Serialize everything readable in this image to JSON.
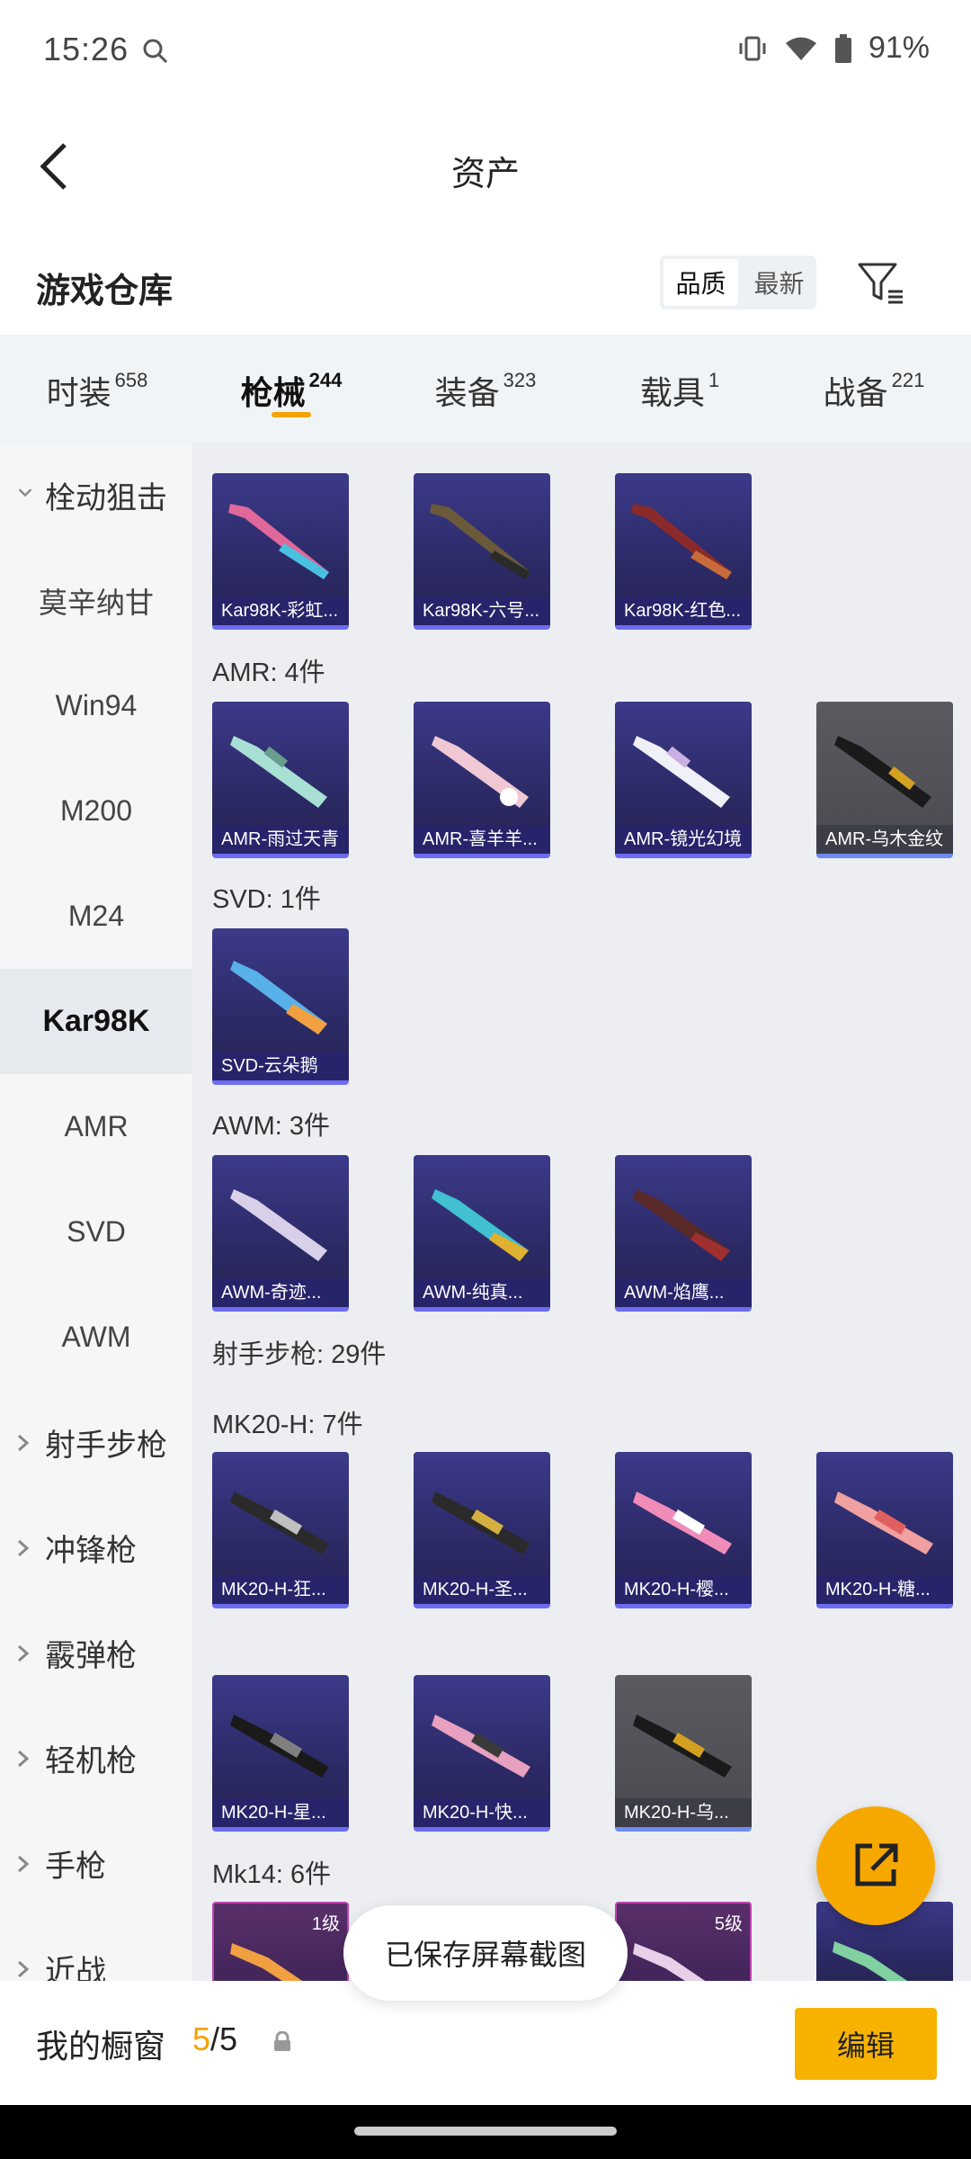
{
  "status_bar": {
    "time": "15:26",
    "battery": "91%"
  },
  "header": {
    "title": "资产"
  },
  "warehouse": {
    "title": "游戏仓库",
    "sort_options": [
      "品质",
      "最新"
    ],
    "active_sort": "品质"
  },
  "category_tabs": [
    {
      "label": "时装",
      "count": "658"
    },
    {
      "label": "枪械",
      "count": "244",
      "active": true
    },
    {
      "label": "装备",
      "count": "323"
    },
    {
      "label": "载具",
      "count": "1"
    },
    {
      "label": "战备",
      "count": "221"
    }
  ],
  "sidebar": {
    "items": [
      {
        "label": "栓动狙击",
        "type": "group-open"
      },
      {
        "label": "莫辛纳甘"
      },
      {
        "label": "Win94"
      },
      {
        "label": "M200"
      },
      {
        "label": "M24"
      },
      {
        "label": "Kar98K",
        "selected": true
      },
      {
        "label": "AMR"
      },
      {
        "label": "SVD"
      },
      {
        "label": "AWM"
      },
      {
        "label": "射手步枪",
        "type": "group"
      },
      {
        "label": "冲锋枪",
        "type": "group"
      },
      {
        "label": "霰弹枪",
        "type": "group"
      },
      {
        "label": "轻机枪",
        "type": "group"
      },
      {
        "label": "手枪",
        "type": "group"
      },
      {
        "label": "近战",
        "type": "group"
      }
    ]
  },
  "sections": {
    "amr": "AMR: 4件",
    "svd": "SVD: 1件",
    "awm": "AWM: 3件",
    "marksman": "射手步枪: 29件",
    "mk20": "MK20-H: 7件",
    "mk14": "Mk14: 6件"
  },
  "cards": {
    "kar": [
      "Kar98K-彩虹...",
      "Kar98K-六号...",
      "Kar98K-红色..."
    ],
    "amr": [
      "AMR-雨过天青",
      "AMR-喜羊羊...",
      "AMR-镜光幻境",
      "AMR-乌木金纹"
    ],
    "svd": [
      "SVD-云朵鹅"
    ],
    "awm": [
      "AWM-奇迹...",
      "AWM-纯真...",
      "AWM-焰鹰..."
    ],
    "mk20_row1": [
      "MK20-H-狂...",
      "MK20-H-圣...",
      "MK20-H-樱...",
      "MK20-H-糖..."
    ],
    "mk20_row2": [
      "MK20-H-星...",
      "MK20-H-快...",
      "MK20-H-乌..."
    ],
    "mk14_levels": [
      "1级",
      "5级"
    ]
  },
  "toast": "已保存屏幕截图",
  "bottom": {
    "showcase_label": "我的橱窗",
    "showcase_current": "5",
    "showcase_total": "/5",
    "edit_label": "编辑"
  }
}
